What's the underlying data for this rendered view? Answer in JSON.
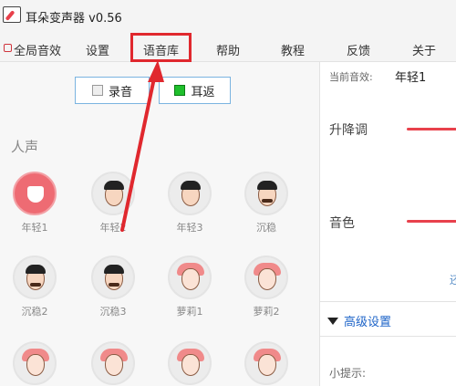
{
  "window": {
    "title": "耳朵变声器 v0.56"
  },
  "menu": [
    {
      "label": "全局音效"
    },
    {
      "label": "设置"
    },
    {
      "label": "语音库"
    },
    {
      "label": "帮助"
    },
    {
      "label": "教程"
    },
    {
      "label": "反馈"
    },
    {
      "label": "关于"
    }
  ],
  "controls": {
    "record": "录音",
    "earback": "耳返"
  },
  "section": {
    "title": "人声"
  },
  "voices": [
    {
      "label": "年轻1",
      "avatar": "check-icon"
    },
    {
      "label": "年轻2",
      "avatar": "boy-face-icon"
    },
    {
      "label": "年轻3",
      "avatar": "boy-face-icon"
    },
    {
      "label": "沉稳",
      "avatar": "mustache-face-icon"
    },
    {
      "label": "沉稳2",
      "avatar": "mustache-face-icon"
    },
    {
      "label": "沉稳3",
      "avatar": "mustache-face-icon"
    },
    {
      "label": "萝莉1",
      "avatar": "girl-face-icon"
    },
    {
      "label": "萝莉2",
      "avatar": "girl-face-icon"
    },
    {
      "label": "",
      "avatar": "girl-face-icon"
    },
    {
      "label": "",
      "avatar": "girl-face-icon"
    },
    {
      "label": "",
      "avatar": "girl-face-icon"
    },
    {
      "label": "",
      "avatar": "girl-face-icon"
    }
  ],
  "panel": {
    "current_label": "当前音效:",
    "current_value": "年轻1",
    "pitch_label": "升降调",
    "timbre_label": "音色",
    "clipped_text": "还",
    "advanced_label": "高级设置",
    "tip_label": "小提示:"
  },
  "colors": {
    "accent": "#e8414c",
    "link": "#1e64c8",
    "annotation": "#e0282e"
  }
}
